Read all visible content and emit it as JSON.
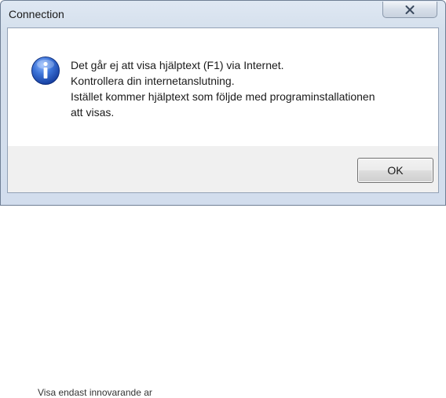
{
  "dialog": {
    "title": "Connection",
    "close_icon": "close-icon",
    "message_icon": "info-icon",
    "message_lines": [
      "Det går ej att visa hjälptext (F1) via Internet.",
      "Kontrollera din internetanslutning.",
      "Istället kommer hjälptext som följde med programinstallationen",
      "att visas."
    ],
    "ok_label": "OK"
  },
  "background": {
    "partial_text": "Visa endast innovarande ar"
  },
  "colors": {
    "window_frame": "#d4dfec",
    "client_area": "#f0f0f0",
    "content_area": "#ffffff",
    "info_icon_blue": "#2a5bb6"
  }
}
